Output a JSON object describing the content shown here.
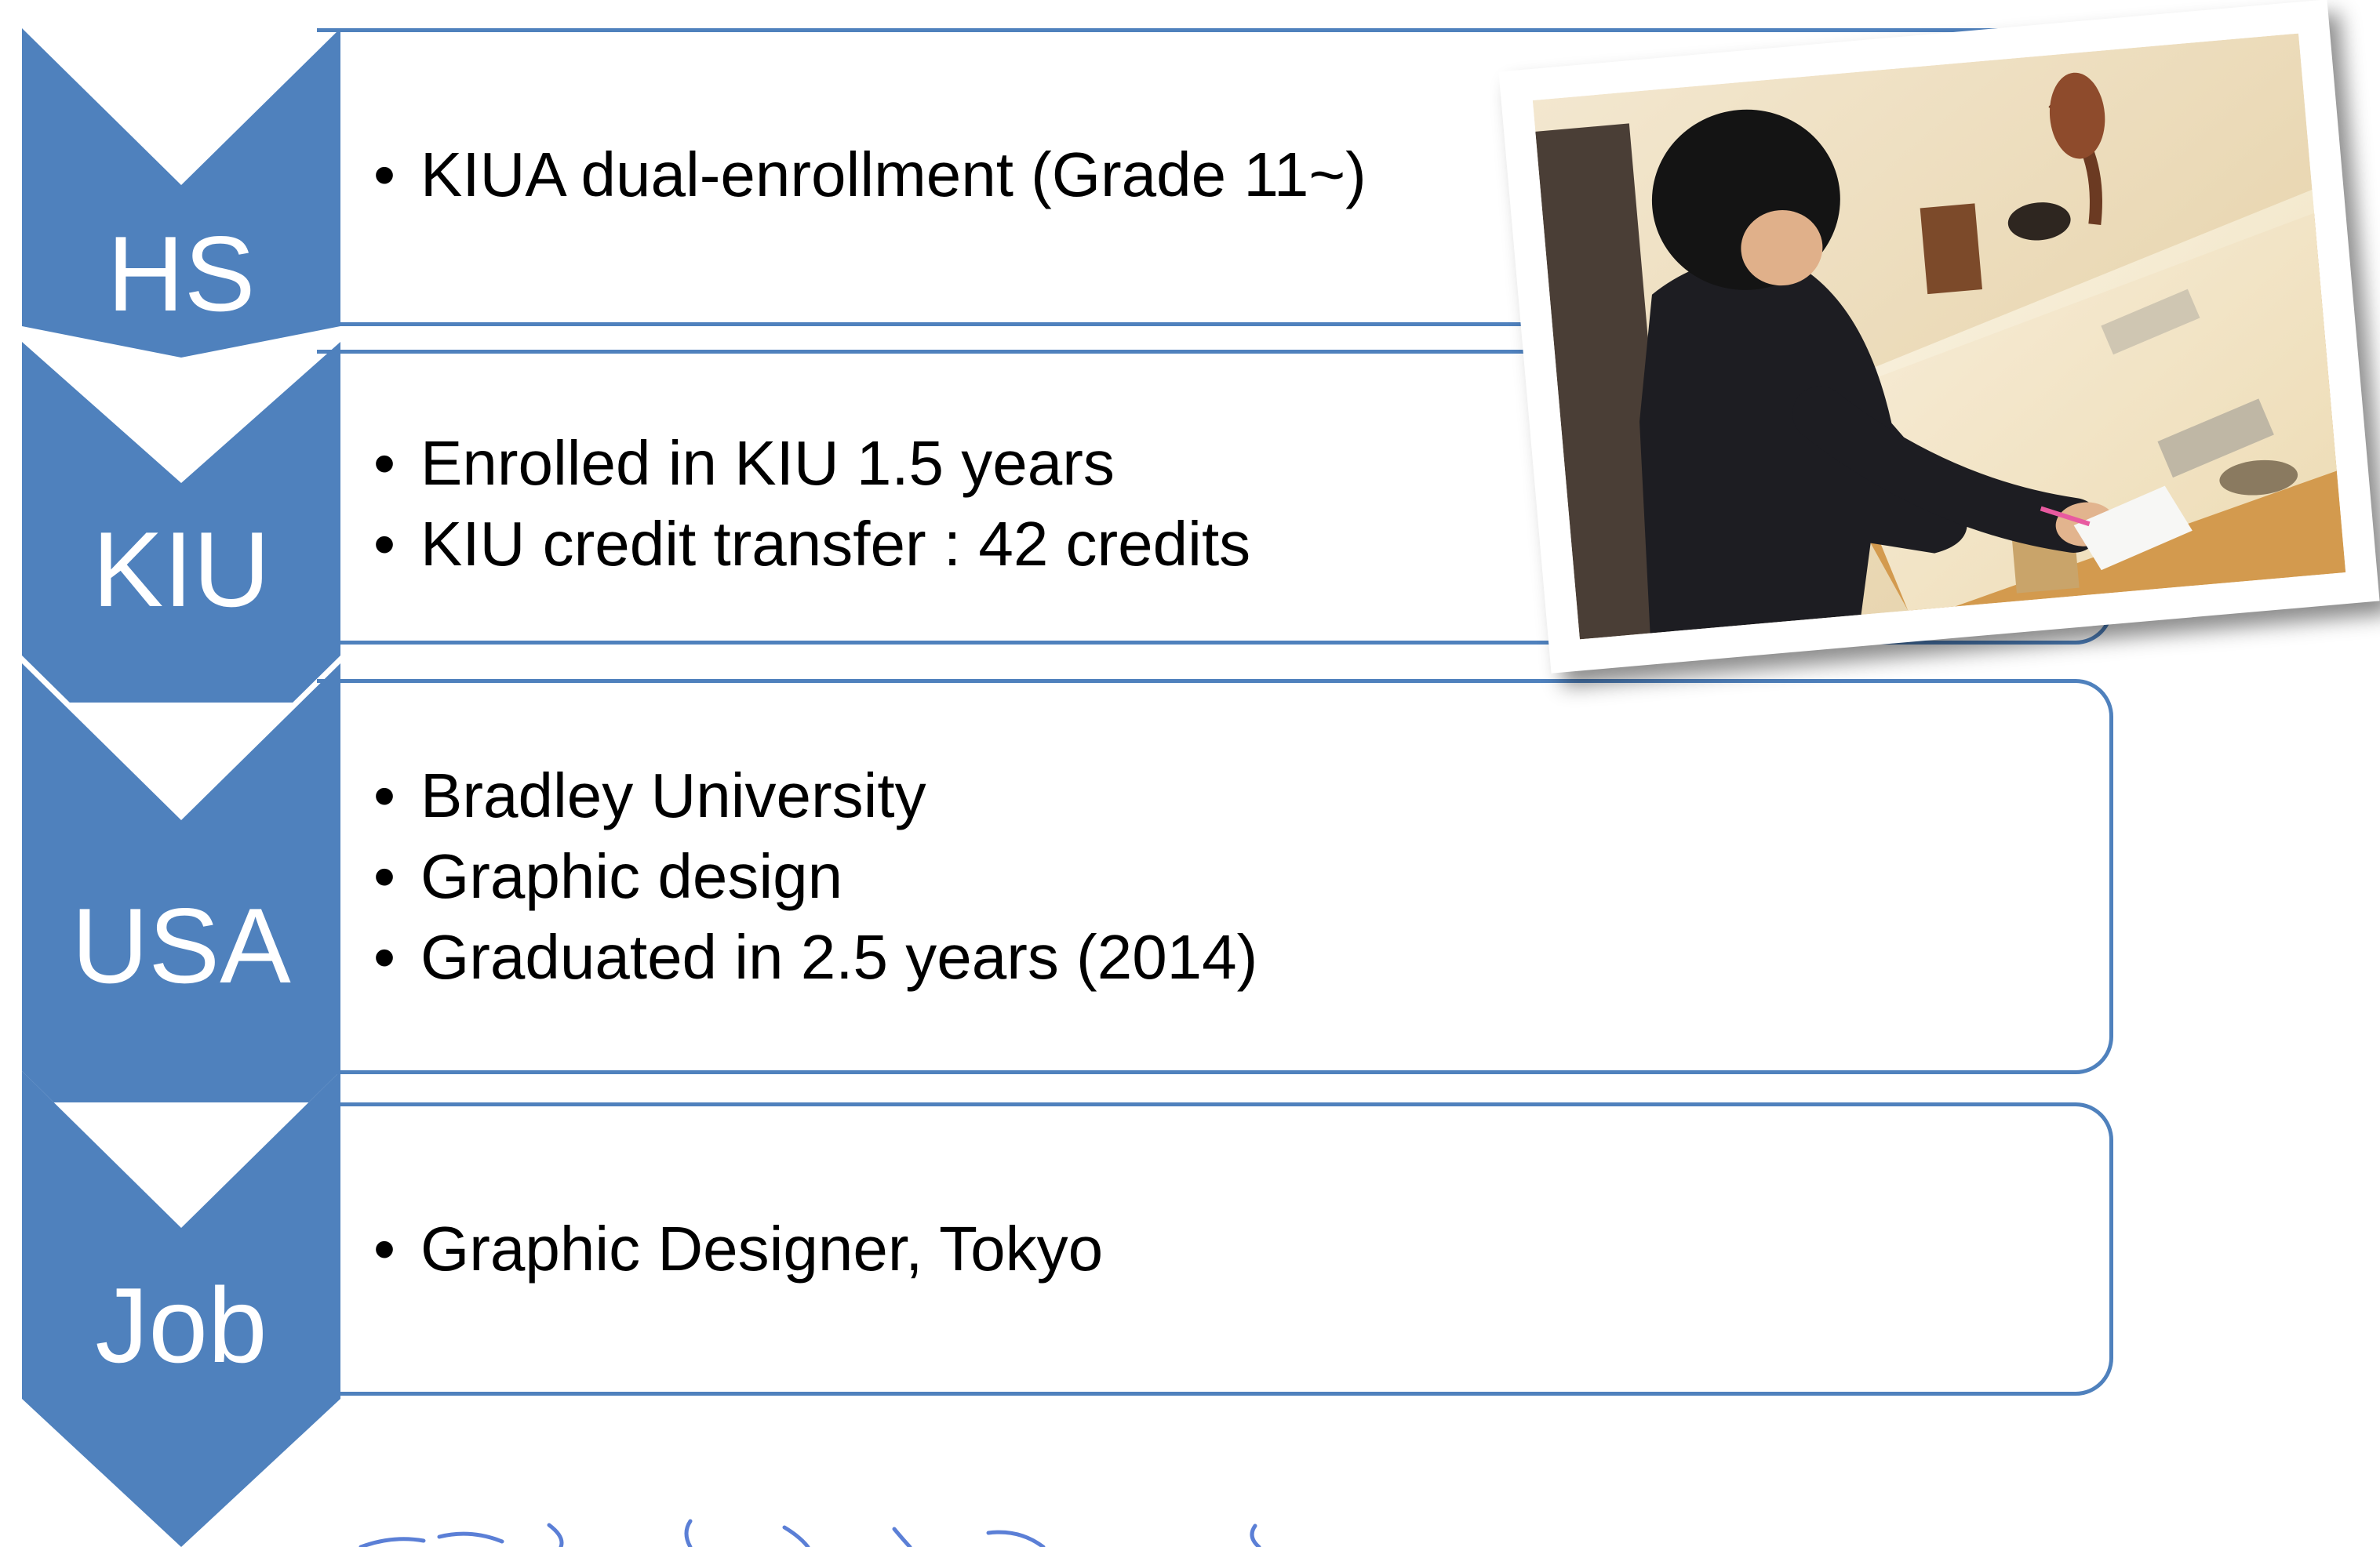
{
  "colors": {
    "chevron_fill": "#4f81bd",
    "box_border": "#4f81bd",
    "label_text": "#ffffff",
    "bullet_text": "#000000",
    "scribble": "#5b7fd6"
  },
  "stages": [
    {
      "label": "HS",
      "bullets": [
        "KIUA dual-enrollment (Grade 11~)"
      ]
    },
    {
      "label": "KIU",
      "bullets": [
        "Enrolled in KIU 1.5 years",
        "KIU credit transfer : 42 credits"
      ]
    },
    {
      "label": "USA",
      "bullets": [
        "Bradley University",
        "Graphic design",
        "Graduated in 2.5 years (2014)"
      ]
    },
    {
      "label": "Job",
      "bullets": [
        "Graphic Designer, Tokyo"
      ]
    }
  ],
  "photo": {
    "subject": "student-writing-at-museum-display-case"
  }
}
